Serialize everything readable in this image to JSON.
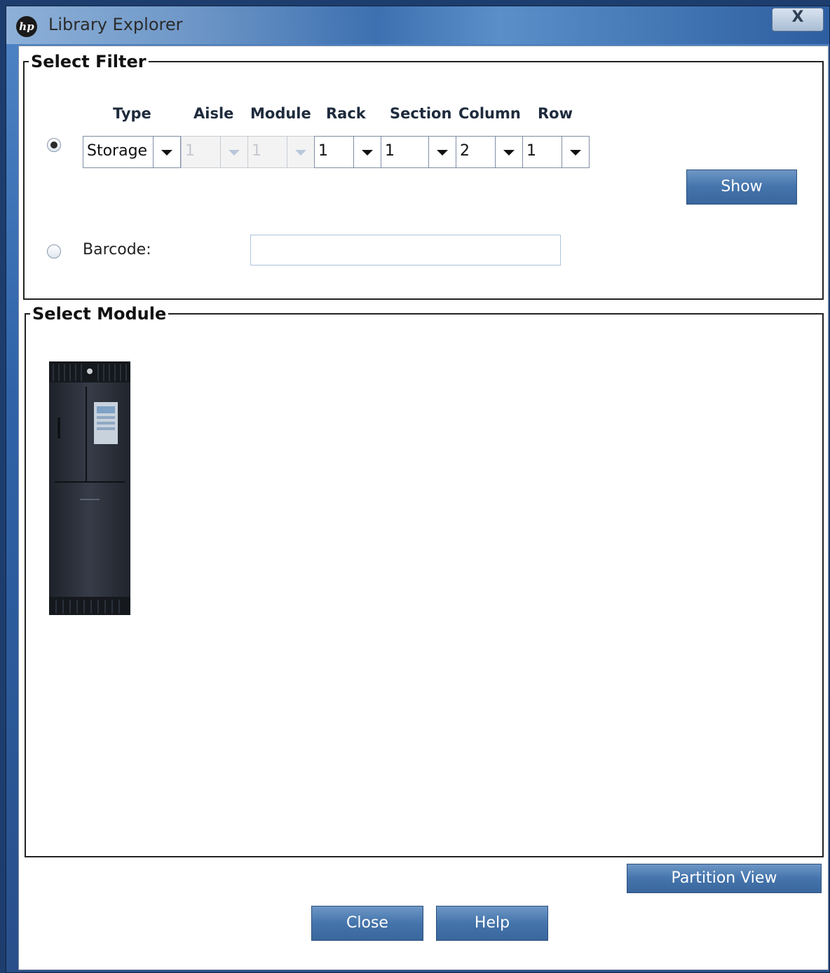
{
  "window": {
    "title": "Library Explorer",
    "logo_text": "hp",
    "close_glyph": "X"
  },
  "filter": {
    "legend": "Select Filter",
    "columns": {
      "type": "Type",
      "aisle": "Aisle",
      "module": "Module",
      "rack": "Rack",
      "section": "Section",
      "column": "Column",
      "row": "Row"
    },
    "values": {
      "type": "Storage",
      "aisle": "1",
      "module": "1",
      "rack": "1",
      "section": "1",
      "column": "2",
      "row": "1"
    },
    "show_label": "Show",
    "barcode_label": "Barcode:",
    "barcode_value": "",
    "selected_option": "location"
  },
  "module": {
    "legend": "Select Module",
    "image": "tape-library-cabinet"
  },
  "footer": {
    "partition_view_label": "Partition View",
    "close_label": "Close",
    "help_label": "Help"
  },
  "colors": {
    "button_blue": "#4474ab",
    "title_bar": "#3d70b0"
  }
}
